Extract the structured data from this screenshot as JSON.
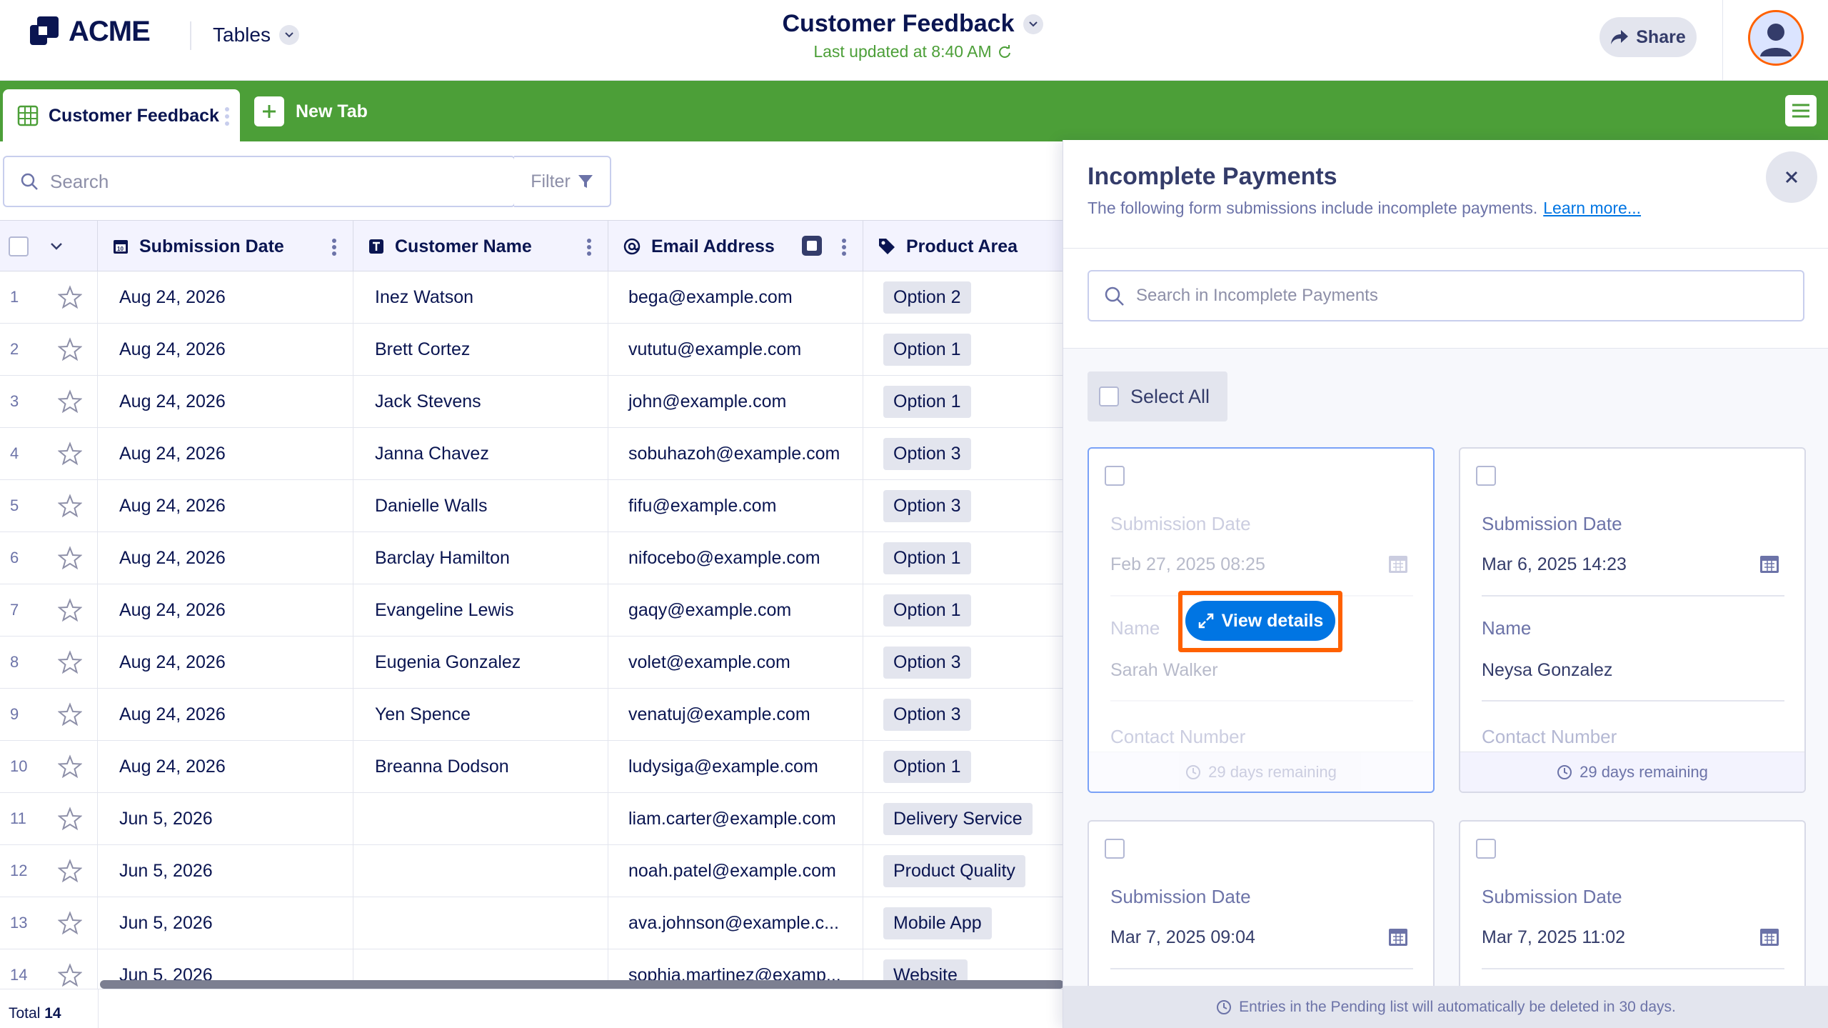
{
  "app": {
    "brand": "ACME",
    "menu_label": "Tables"
  },
  "document": {
    "title": "Customer Feedback",
    "last_updated": "Last updated at 8:40 AM"
  },
  "header": {
    "share_label": "Share"
  },
  "tabs": [
    {
      "label": "Customer Feedback",
      "active": true
    },
    {
      "label": "New Tab",
      "active": false
    }
  ],
  "toolbar": {
    "search_placeholder": "Search",
    "filter_label": "Filter"
  },
  "table": {
    "columns": [
      "Submission Date",
      "Customer Name",
      "Email Address",
      "Product Area"
    ],
    "rows": [
      {
        "n": "1",
        "date": "Aug 24, 2026",
        "name": "Inez Watson",
        "email": "bega@example.com",
        "area": "Option 2"
      },
      {
        "n": "2",
        "date": "Aug 24, 2026",
        "name": "Brett Cortez",
        "email": "vututu@example.com",
        "area": "Option 1"
      },
      {
        "n": "3",
        "date": "Aug 24, 2026",
        "name": "Jack Stevens",
        "email": "john@example.com",
        "area": "Option 1"
      },
      {
        "n": "4",
        "date": "Aug 24, 2026",
        "name": "Janna Chavez",
        "email": "sobuhazoh@example.com",
        "area": "Option 3"
      },
      {
        "n": "5",
        "date": "Aug 24, 2026",
        "name": "Danielle Walls",
        "email": "fifu@example.com",
        "area": "Option 3"
      },
      {
        "n": "6",
        "date": "Aug 24, 2026",
        "name": "Barclay Hamilton",
        "email": "nifocebo@example.com",
        "area": "Option 1"
      },
      {
        "n": "7",
        "date": "Aug 24, 2026",
        "name": "Evangeline Lewis",
        "email": "gaqy@example.com",
        "area": "Option 1"
      },
      {
        "n": "8",
        "date": "Aug 24, 2026",
        "name": "Eugenia Gonzalez",
        "email": "volet@example.com",
        "area": "Option 3"
      },
      {
        "n": "9",
        "date": "Aug 24, 2026",
        "name": "Yen Spence",
        "email": "venatuj@example.com",
        "area": "Option 3"
      },
      {
        "n": "10",
        "date": "Aug 24, 2026",
        "name": "Breanna Dodson",
        "email": "ludysiga@example.com",
        "area": "Option 1"
      },
      {
        "n": "11",
        "date": "Jun 5, 2026",
        "name": "",
        "email": "liam.carter@example.com",
        "area": "Delivery Service"
      },
      {
        "n": "12",
        "date": "Jun 5, 2026",
        "name": "",
        "email": "noah.patel@example.com",
        "area": "Product Quality"
      },
      {
        "n": "13",
        "date": "Jun 5, 2026",
        "name": "",
        "email": "ava.johnson@example.c...",
        "area": "Mobile App"
      },
      {
        "n": "14",
        "date": "Jun 5, 2026",
        "name": "",
        "email": "sophia.martinez@examp...",
        "area": "Website"
      }
    ],
    "total_label": "Total",
    "total_value": "14"
  },
  "panel": {
    "title": "Incomplete Payments",
    "description": "The following form submissions include incomplete payments.",
    "learn_more": "Learn more...",
    "search_placeholder": "Search in Incomplete Payments",
    "select_all": "Select All",
    "field_date_label": "Submission Date",
    "field_name_label": "Name",
    "field_contact_label": "Contact Number",
    "view_details": "View details",
    "cards": [
      {
        "date": "Feb 27, 2025 08:25",
        "name": "Sarah Walker",
        "remaining": "29 days remaining"
      },
      {
        "date": "Mar 6, 2025 14:23",
        "name": "Neysa Gonzalez",
        "remaining": "29 days remaining"
      },
      {
        "date": "Mar 7, 2025 09:04"
      },
      {
        "date": "Mar 7, 2025 11:02"
      }
    ],
    "footer_note": "Entries in the Pending list will automatically be deleted in 30 days."
  },
  "colors": {
    "brand_green": "#4c9f38",
    "accent_blue": "#0075e3",
    "highlight_orange": "#ff6100",
    "navy": "#0a1551"
  }
}
